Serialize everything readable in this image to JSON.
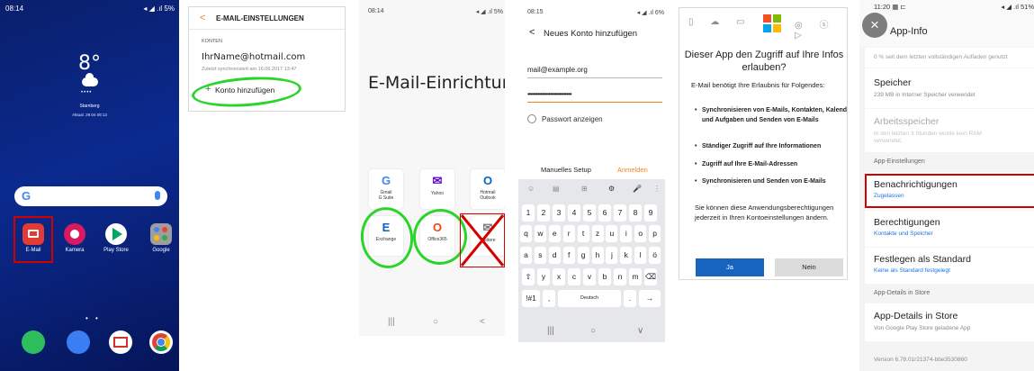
{
  "home": {
    "status_time": "08:14",
    "status_right": "◂ ◢ .ıl 5%",
    "temperature": "8°",
    "rain": "••••",
    "city": "Starnberg",
    "updated": "Aktual. 29.04 08:13",
    "search_g": "G",
    "apps": [
      {
        "label": "E-Mail",
        "color": "#e53935"
      },
      {
        "label": "Kamera",
        "color": "#d81b60"
      },
      {
        "label": "Play Store",
        "color": "#ffffff"
      },
      {
        "label": "Google",
        "color": "#9e9e9e"
      }
    ],
    "page_dots": "• •",
    "dock": [
      {
        "name": "phone",
        "color": "#2ebd5c"
      },
      {
        "name": "messages",
        "color": "#3b7df2"
      },
      {
        "name": "gmail",
        "color": "#ffffff"
      },
      {
        "name": "chrome",
        "color": "#ffffff"
      }
    ]
  },
  "email_settings": {
    "back": "<",
    "title": "E-MAIL-EINSTELLUNGEN",
    "section": "KONTEN",
    "address": "IhrName@hotmail.com",
    "synced": "Zuletzt synchronisiert am 16.06.2017 13:47",
    "add_plus": "+",
    "add_account": "Konto hinzufügen",
    "highlight_color": "#2bd42b"
  },
  "setup": {
    "status_time": "08:14",
    "status_right": "◂ ◢ .ıl 5%",
    "heading": "E-Mail-Einrichtung",
    "providers": [
      {
        "icon": "G",
        "label": "Gmail\nG Suite",
        "color": "#4285f4"
      },
      {
        "icon": "✉",
        "label": "Yahoo",
        "color": "#5f01d1"
      },
      {
        "icon": "O",
        "label": "Hotmail\nOutlook",
        "color": "#0a64c8"
      },
      {
        "icon": "E",
        "label": "Exchange",
        "color": "#0a64c8"
      },
      {
        "icon": "O",
        "label": "Office365",
        "color": "#e64a19"
      },
      {
        "icon": "✉",
        "label": "Weitere",
        "color": "#777777"
      }
    ],
    "nav": [
      "|||",
      "○",
      "<"
    ]
  },
  "new_account": {
    "status_time": "08:15",
    "status_right": "◂ ◢ .ıl 6%",
    "back": "<",
    "title": "Neues Konto hinzufügen",
    "email_value": "mail@example.org",
    "password_value": "•••••••••••••••••••••••••••",
    "show_password": "Passwort anzeigen",
    "manual_setup": "Manuelles Setup",
    "sign_in": "Anmelden",
    "keyboard_top": [
      "☺",
      "▤",
      "⊞",
      "⚙",
      "🎤",
      "⋮"
    ],
    "row1": [
      "1",
      "2",
      "3",
      "4",
      "5",
      "6",
      "7",
      "8",
      "9"
    ],
    "row2": [
      "q",
      "w",
      "e",
      "r",
      "t",
      "z",
      "u",
      "i",
      "o",
      "p"
    ],
    "row3": [
      "a",
      "s",
      "d",
      "f",
      "g",
      "h",
      "j",
      "k",
      "l",
      "ö"
    ],
    "row4": [
      "⇧",
      "y",
      "x",
      "c",
      "v",
      "b",
      "n",
      "m",
      "⌫"
    ],
    "row5": [
      "!#1",
      ",",
      "Deutsch",
      ".",
      "→"
    ],
    "nav": [
      "|||",
      "○",
      "∨"
    ]
  },
  "permission": {
    "question": "Dieser App den Zugriff auf Ihre Infos erlauben?",
    "intro": "E-Mail benötigt Ihre Erlaubnis für Folgendes:",
    "items": [
      "Synchronisieren von E-Mails, Kontakten, Kalender und Aufgaben und Senden von E-Mails",
      "Ständiger Zugriff auf Ihre Informationen",
      "Zugriff auf Ihre E-Mail-Adressen",
      "Synchronisieren und Senden von E-Mails"
    ],
    "note": "Sie können diese Anwendungsberechtigungen jederzeit in Ihren Kontoeinstellungen ändern.",
    "yes": "Ja",
    "no": "Nein",
    "top_icons": "▯ ☁ ▭",
    "top_icons_right": "◎ ⓢ ▷"
  },
  "app_info": {
    "status_left": "11:20 ▦ ⊏",
    "status_right": "◂ ◢ .ıl 51%",
    "close": "×",
    "title": "App-Info",
    "battery_note": "0 % seit dem letzten vollständigen Aufladen genutzt",
    "storage_title": "Speicher",
    "storage_sub": "239 MB in Interner Speicher verwendet",
    "memory_title": "Arbeitsspeicher",
    "memory_sub": "In den letzten 3 Stunden wurde kein RAM verwendet.",
    "app_settings_header": "App-Einstellungen",
    "notifications_title": "Benachrichtigungen",
    "notifications_sub": "Zugelassen",
    "permissions_title": "Berechtigungen",
    "permissions_sub": "Kontakte und Speicher",
    "defaults_title": "Festlegen als Standard",
    "defaults_sub": "Keine als Standard festgelegt",
    "store_header": "App-Details in Store",
    "store_title": "App-Details in Store",
    "store_sub": "Von Google Play Store geladene App",
    "version": "Version 6.78.01r21374-bbe3530860"
  }
}
